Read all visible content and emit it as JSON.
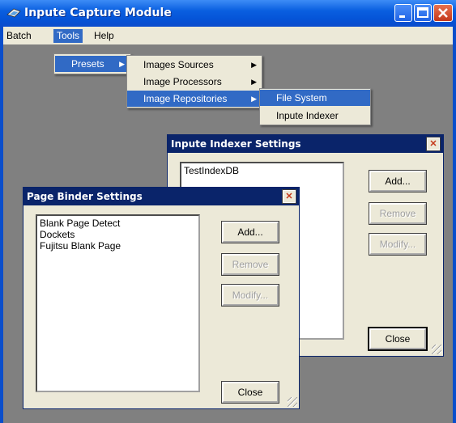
{
  "window": {
    "title": "Inpute Capture Module",
    "colors": {
      "titlebar": "#0554d8",
      "client": "#808080",
      "highlight": "#316ac5",
      "dialog": "#ece9d8"
    }
  },
  "menubar": {
    "items": [
      "Batch",
      "Tools",
      "Help"
    ],
    "active": "Tools"
  },
  "menus": {
    "tools": [
      "Presets"
    ],
    "presets": [
      "Images Sources",
      "Image Processors",
      "Image Repositories"
    ],
    "repositories": [
      "File System",
      "Inpute Indexer"
    ]
  },
  "indexer_dialog": {
    "title": "Inpute Indexer Settings",
    "items": [
      "TestIndexDB"
    ],
    "buttons": {
      "add": "Add...",
      "remove": "Remove",
      "modify": "Modify...",
      "close": "Close"
    }
  },
  "binder_dialog": {
    "title": "Page Binder Settings",
    "items": [
      "Blank Page Detect",
      "Dockets",
      "Fujitsu Blank Page"
    ],
    "buttons": {
      "add": "Add...",
      "remove": "Remove",
      "modify": "Modify...",
      "close": "Close"
    }
  },
  "icons": [
    "app-icon",
    "minimize-icon",
    "maximize-icon",
    "close-icon",
    "submenu-arrow-icon",
    "resize-grip-icon"
  ]
}
